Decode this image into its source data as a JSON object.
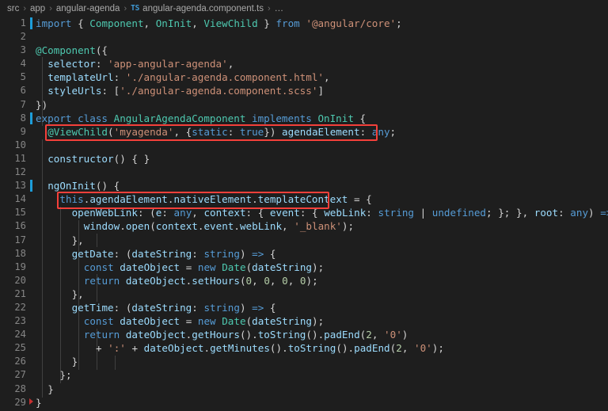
{
  "breadcrumb": {
    "items": [
      "src",
      "app",
      "angular-agenda"
    ],
    "file_icon": "TS",
    "file": "angular-agenda.component.ts",
    "overflow": "…",
    "separator": "›"
  },
  "colors": {
    "background": "#1e1e1e",
    "line_number": "#858585",
    "change_bar": "#1d9dd9",
    "annotation_box": "#f4403a",
    "error_marker": "#c72f30",
    "keyword": "#569cd6",
    "string": "#ce9178",
    "identifier": "#9cdcfe",
    "type": "#4ec9b0",
    "number": "#b5cea8",
    "plain": "#d4d4d4"
  },
  "editor": {
    "language": "TypeScript",
    "first_line": 1,
    "last_line": 29,
    "lines": [
      {
        "n": 1,
        "changed": true,
        "text": "import { Component, OnInit, ViewChild } from '@angular/core';"
      },
      {
        "n": 2,
        "changed": false,
        "text": ""
      },
      {
        "n": 3,
        "changed": false,
        "text": "@Component({"
      },
      {
        "n": 4,
        "changed": false,
        "text": "  selector: 'app-angular-agenda',"
      },
      {
        "n": 5,
        "changed": false,
        "text": "  templateUrl: './angular-agenda.component.html',"
      },
      {
        "n": 6,
        "changed": false,
        "text": "  styleUrls: ['./angular-agenda.component.scss']"
      },
      {
        "n": 7,
        "changed": false,
        "text": "})"
      },
      {
        "n": 8,
        "changed": true,
        "text": "export class AngularAgendaComponent implements OnInit {"
      },
      {
        "n": 9,
        "changed": false,
        "text": "  @ViewChild('myagenda', {static: true}) agendaElement: any;"
      },
      {
        "n": 10,
        "changed": false,
        "text": ""
      },
      {
        "n": 11,
        "changed": false,
        "text": "  constructor() { }"
      },
      {
        "n": 12,
        "changed": false,
        "text": ""
      },
      {
        "n": 13,
        "changed": true,
        "text": "  ngOnInit() {"
      },
      {
        "n": 14,
        "changed": false,
        "text": "    this.agendaElement.nativeElement.templateContext = {"
      },
      {
        "n": 15,
        "changed": false,
        "text": "      openWebLink: (e: any, context: { event: { webLink: string | undefined; }; }, root: any) => {"
      },
      {
        "n": 16,
        "changed": false,
        "text": "        window.open(context.event.webLink, '_blank');"
      },
      {
        "n": 17,
        "changed": false,
        "text": "      },"
      },
      {
        "n": 18,
        "changed": false,
        "text": "      getDate: (dateString: string) => {"
      },
      {
        "n": 19,
        "changed": false,
        "text": "        const dateObject = new Date(dateString);"
      },
      {
        "n": 20,
        "changed": false,
        "text": "        return dateObject.setHours(0, 0, 0, 0);"
      },
      {
        "n": 21,
        "changed": false,
        "text": "      },"
      },
      {
        "n": 22,
        "changed": false,
        "text": "      getTime: (dateString: string) => {"
      },
      {
        "n": 23,
        "changed": false,
        "text": "        const dateObject = new Date(dateString);"
      },
      {
        "n": 24,
        "changed": false,
        "text": "        return dateObject.getHours().toString().padEnd(2, '0')"
      },
      {
        "n": 25,
        "changed": false,
        "text": "          + ':' + dateObject.getMinutes().toString().padEnd(2, '0');"
      },
      {
        "n": 26,
        "changed": false,
        "text": "      }"
      },
      {
        "n": 27,
        "changed": false,
        "text": "    };"
      },
      {
        "n": 28,
        "changed": false,
        "text": "  }"
      },
      {
        "n": 29,
        "changed": false,
        "error": true,
        "text": "}"
      }
    ]
  },
  "annotations": [
    {
      "id": "viewchild-highlight",
      "line": 9,
      "label": "@ViewChild('myagenda', {static: true}) agendaElement: any;"
    },
    {
      "id": "templatecontext-highlight",
      "line": 14,
      "label": "this.agendaElement.nativeElement.templateContext"
    }
  ]
}
